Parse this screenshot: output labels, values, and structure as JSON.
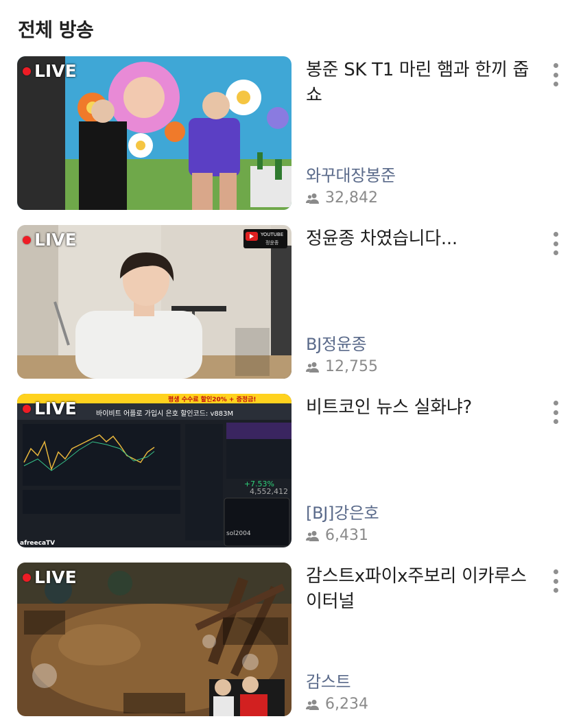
{
  "section": {
    "title": "전체 방송"
  },
  "live_label": "LIVE",
  "streams": [
    {
      "title": "봉준 SK T1 마린 햄과 한끼 줍쇼",
      "streamer": "와꾸대장봉준",
      "viewers": "32,842"
    },
    {
      "title": "정윤종 차였습니다...",
      "streamer": "BJ정윤종",
      "viewers": "12,755",
      "overlay": {
        "channel_top": "YOUTUBE",
        "channel_name": "정윤종"
      }
    },
    {
      "title": "비트코인 뉴스 실화냐?",
      "streamer": "[BJ]강은호",
      "viewers": "6,431",
      "overlay": {
        "banner": "평생 수수료 할인20% + 증정금!",
        "headline": "바이비트 어플로 가입시 은호 할인코드: v883M",
        "change": "+7.53%",
        "price": "4,552,412",
        "user": "sol2004",
        "brand": "afreecaTV"
      }
    },
    {
      "title": "감스트x파이x주보리 이카루스이터널",
      "streamer": "감스트",
      "viewers": "6,234"
    }
  ],
  "colors": {
    "live_dot": "#ee1c25",
    "streamer_text": "#5a6a8a",
    "meta_text": "#8a8a8a"
  },
  "icons": {
    "viewer": "people-icon",
    "more": "more-vertical-icon"
  }
}
